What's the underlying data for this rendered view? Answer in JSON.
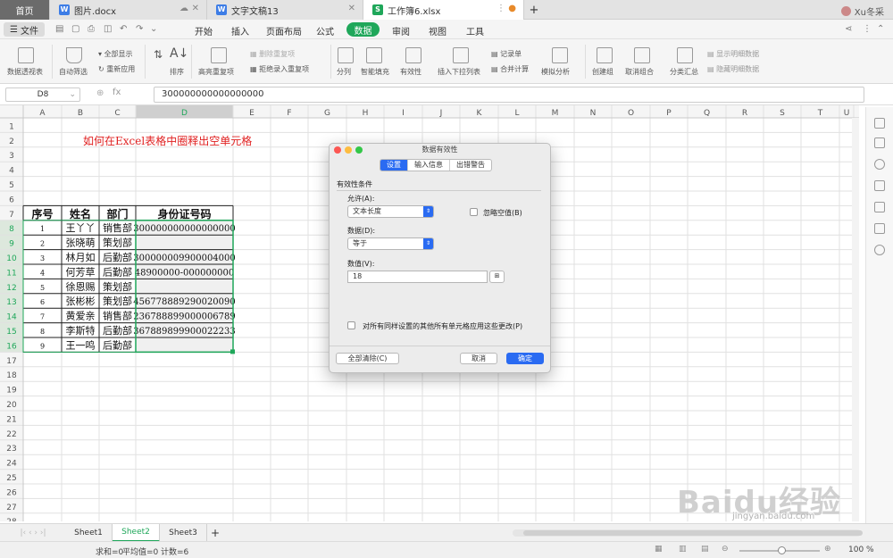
{
  "tabs": {
    "home": "首页",
    "docs": [
      {
        "name": "图片.docx",
        "icon": "W"
      },
      {
        "name": "文字文稿13",
        "icon": "W"
      },
      {
        "name": "工作簿6.xlsx",
        "icon": "S"
      }
    ],
    "add": "+"
  },
  "user": {
    "name": "Xu冬采"
  },
  "menu": {
    "file": "文件",
    "items": [
      "开始",
      "插入",
      "页面布局",
      "公式",
      "数据",
      "审阅",
      "视图",
      "工具"
    ],
    "active": "数据"
  },
  "toolbar": {
    "pivot": "数据透视表",
    "autofilter": "自动筛选",
    "show_all": "全部显示",
    "reapply": "重新应用",
    "sort": "排序",
    "highlight_dup": "高亮重复项",
    "delete_dup": "删除重复项",
    "reject_dup": "拒绝录入重复项",
    "split": "分列",
    "smart_fill": "智能填充",
    "validity": "有效性",
    "insert_dropdown": "插入下拉列表",
    "record": "记录单",
    "merge_calc": "合并计算",
    "simulate": "模拟分析",
    "create_group": "创建组",
    "ungroup": "取消组合",
    "subtotal": "分类汇总",
    "show_detail": "显示明细数据",
    "hide_detail": "隐藏明细数据"
  },
  "formula_bar": {
    "name": "D8",
    "fx": "fx",
    "value": "300000000000000000"
  },
  "columns": [
    "A",
    "B",
    "C",
    "D",
    "E",
    "F",
    "G",
    "H",
    "I",
    "J",
    "K",
    "L",
    "M",
    "N",
    "O",
    "P",
    "Q",
    "R",
    "S",
    "T",
    "U"
  ],
  "sheet_title": "如何在Excel表格中圈释出空单元格",
  "table": {
    "headers": [
      "序号",
      "姓名",
      "部门",
      "身份证号码"
    ],
    "rows": [
      [
        "1",
        "王丫丫",
        "销售部",
        "300000000000000000"
      ],
      [
        "2",
        "张晓萌",
        "策划部",
        ""
      ],
      [
        "3",
        "林月如",
        "后勤部",
        "300000009900004000"
      ],
      [
        "4",
        "何芳草",
        "后勤部",
        "48900000-000000000"
      ],
      [
        "5",
        "徐恩赐",
        "策划部",
        ""
      ],
      [
        "6",
        "张彬彬",
        "策划部",
        "456778889290020090"
      ],
      [
        "7",
        "黄爱亲",
        "销售部",
        "236788899000006789"
      ],
      [
        "8",
        "李斯特",
        "后勤部",
        "367889899900022233"
      ],
      [
        "9",
        "王一鸣",
        "后勤部",
        ""
      ]
    ]
  },
  "dialog": {
    "title": "数据有效性",
    "tabs": [
      "设置",
      "输入信息",
      "出错警告"
    ],
    "active_tab": "设置",
    "section": "有效性条件",
    "allow_label": "允许(A):",
    "allow_value": "文本长度",
    "ignore_blank": "忽略空值(B)",
    "data_label": "数据(D):",
    "data_value": "等于",
    "value_label": "数值(V):",
    "value": "18",
    "apply_all": "对所有同样设置的其他所有单元格应用这些更改(P)",
    "clear_all": "全部清除(C)",
    "cancel": "取消",
    "ok": "确定"
  },
  "sheets": [
    "Sheet1",
    "Sheet2",
    "Sheet3"
  ],
  "active_sheet": "Sheet2",
  "status": {
    "sum": "求和=0",
    "avg": "平均值=0",
    "count": "计数=6",
    "zoom": "100 %"
  },
  "watermark": {
    "brand": "Baidu经验",
    "url": "jingyan.baidu.com"
  },
  "colors": {
    "accent": "#1fa75a",
    "dialog_blue": "#2a6bf2",
    "title_red": "#e02020"
  }
}
